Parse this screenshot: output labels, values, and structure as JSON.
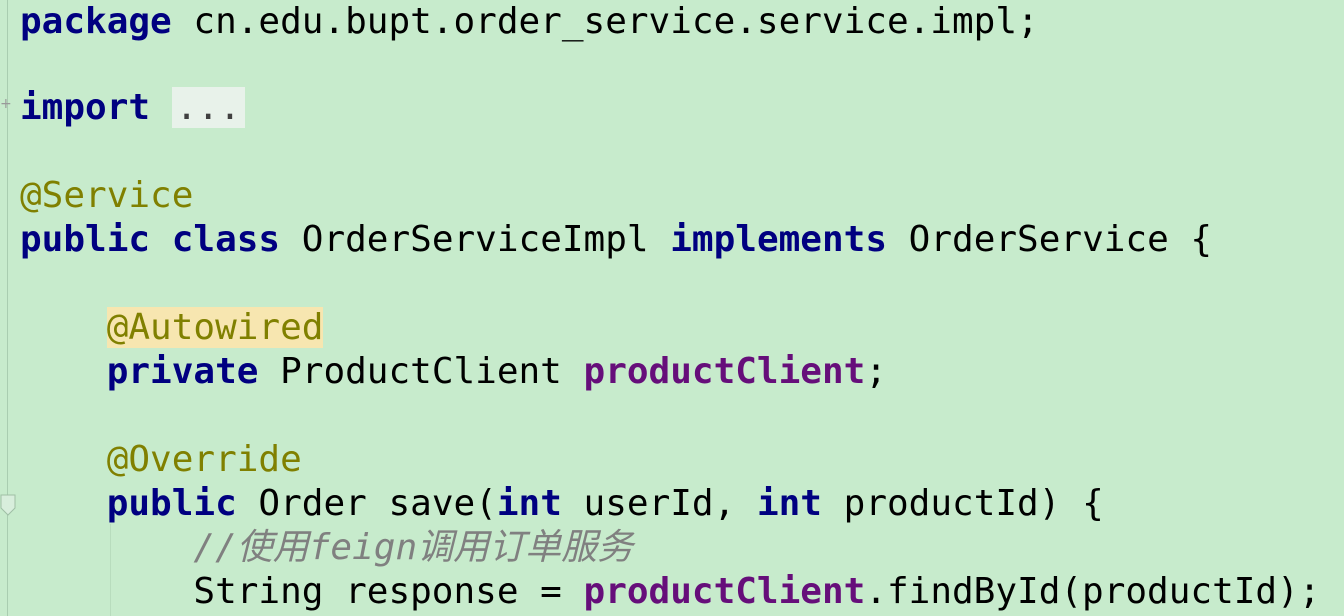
{
  "code": {
    "package_kw": "package",
    "package_name": " cn.edu.bupt.order_service.service.impl;",
    "import_kw": "import",
    "import_fold": "...",
    "service_ann": "@Service",
    "public_kw": "public",
    "class_kw": "class",
    "class_name": " OrderServiceImpl ",
    "implements_kw": "implements",
    "interface_name": " OrderService {",
    "autowired_ann": "@Autowired",
    "private_kw": "private",
    "field_type": " ProductClient ",
    "field_name": "productClient",
    "semicolon": ";",
    "override_ann": "@Override",
    "method_public_kw": "public",
    "method_sig_1": " Order save(",
    "int_kw_1": "int",
    "param_1": " userId, ",
    "int_kw_2": "int",
    "param_2": " productId) {",
    "comment_prefix": "//使用",
    "comment_feign": "feign",
    "comment_suffix": "调用订单服务",
    "stmt_prefix": "String response = ",
    "stmt_field": "productClient",
    "stmt_suffix": ".findById(productId);"
  },
  "colors": {
    "background": "#c7ebcc",
    "keyword": "#000080",
    "annotation": "#808000",
    "field": "#660e7a",
    "comment": "#808080"
  },
  "icons": {
    "fold_expand": "plus-icon",
    "fold_collapse": "fold-marker-icon"
  }
}
